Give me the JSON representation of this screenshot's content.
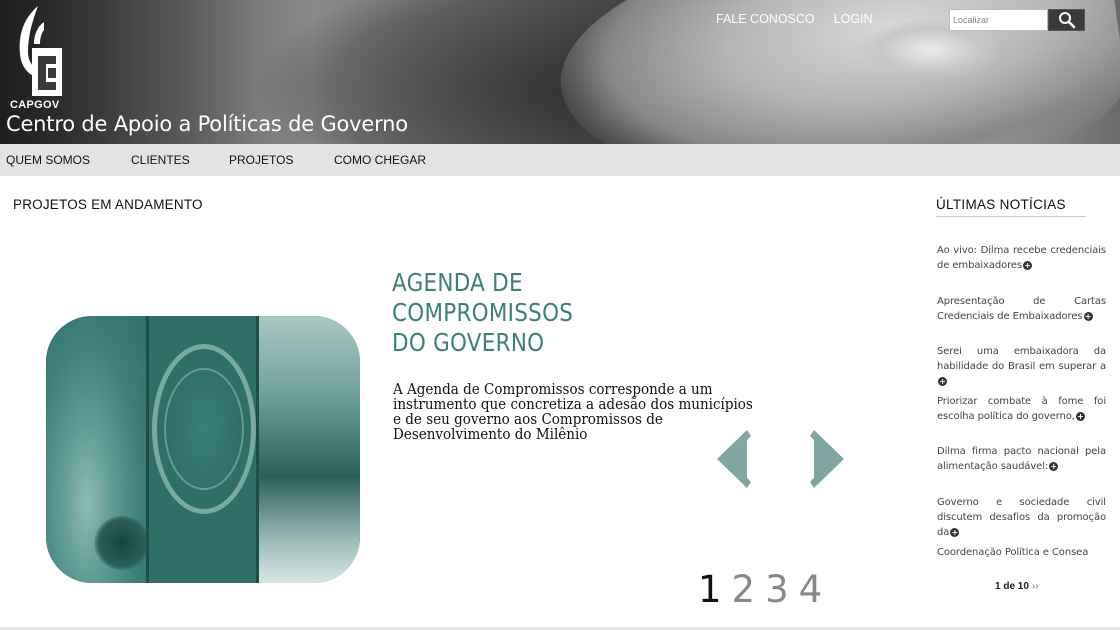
{
  "header": {
    "logo_text": "CAPGOV",
    "site_title": "Centro de Apoio a Políticas de Governo",
    "links": [
      "FALE CONOSCO",
      "LOGIN"
    ],
    "search": {
      "placeholder": "Localizar",
      "button_icon": "search-icon"
    }
  },
  "nav": {
    "items": [
      "QUEM SOMOS",
      "CLIENTES",
      "PROJETOS",
      "COMO CHEGAR"
    ]
  },
  "main": {
    "section_title": "PROJETOS EM ANDAMENTO",
    "slide": {
      "title_line1": "AGENDA DE COMPROMISSOS",
      "title_line2": "DO GOVERNO",
      "text": "A Agenda de Compromissos corresponde a um instrumento que concretiza a adesão dos municípios e de seu governo aos Compromissos de Desenvolvimento do Milênio"
    },
    "pager": [
      "1",
      "2",
      "3",
      "4"
    ],
    "active_page": "1",
    "accent_color": "#3f7f78"
  },
  "sidebar": {
    "title": "ÚLTIMAS NOTÍCIAS",
    "items": [
      "Ao vivo: Dilma recebe credenciais de embaixadores",
      "Apresentação de Cartas Credenciais de Embaixadores",
      "Serei uma embaixadora da habilidade do Brasil em superar a",
      "Priorizar combate à fome foi escolha política do governo,",
      "Dilma firma pacto nacional pela alimentação saudável:",
      "Governo e sociedade civil discutem desafios da promoção da",
      "Coordenação Política e Consea"
    ],
    "pager_text": "1 de 10",
    "pager_next": "››"
  }
}
